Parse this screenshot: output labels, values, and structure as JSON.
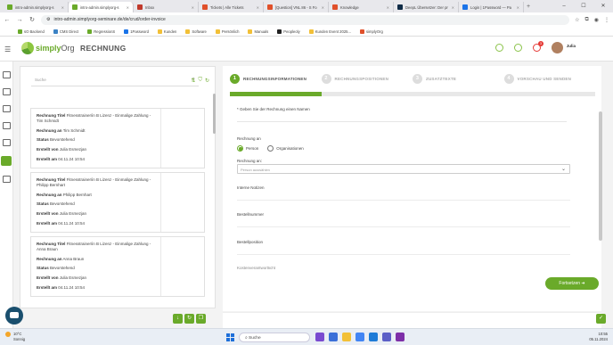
{
  "browser": {
    "tabs": [
      {
        "label": "intro-admin.simplyorg-s",
        "color": "#6aaa2a",
        "active": false
      },
      {
        "label": "intro-admin.simplyorg-s",
        "color": "#6aaa2a",
        "active": true
      },
      {
        "label": "Inbox",
        "color": "#c0392b",
        "active": false
      },
      {
        "label": "Tickets | Alle Tickets",
        "color": "#e0502a",
        "active": false
      },
      {
        "label": "[Question] VNL 86 - S Fo",
        "color": "#e0502a",
        "active": false
      },
      {
        "label": "Knowledge",
        "color": "#e0502a",
        "active": false
      },
      {
        "label": "DeepL Übersetzer: Der pr",
        "color": "#0f2b46",
        "active": false
      },
      {
        "label": "Login | 1Password — Pa",
        "color": "#1a73e8",
        "active": false
      }
    ],
    "url": "intro-admin.simplyorg-seminare.de/de/crud/order-invoice",
    "bookmarks": [
      {
        "label": "sO Backend",
        "color": "#6aaa2a"
      },
      {
        "label": "CMS Direct",
        "color": "#3b82c4"
      },
      {
        "label": "RegressionS",
        "color": "#6aaa2a"
      },
      {
        "label": "1Password",
        "color": "#1a73e8"
      },
      {
        "label": "Kunden",
        "color": "#f2c037"
      },
      {
        "label": "Software",
        "color": "#f2c037"
      },
      {
        "label": "Persönlich",
        "color": "#f2c037"
      },
      {
        "label": "Manuals",
        "color": "#f2c037"
      },
      {
        "label": "Peopleoly",
        "color": "#222"
      },
      {
        "label": "Kunden Event 2025...",
        "color": "#f2c037"
      },
      {
        "label": "simplyOrg",
        "color": "#e0502a"
      }
    ]
  },
  "app": {
    "logo_brand": "simply",
    "logo_suffix": "Org",
    "title": "RECHNUNG",
    "user_name": "Julia",
    "notification_count": "3"
  },
  "left_panel": {
    "search_placeholder": "Suche",
    "cards": [
      {
        "title_label": "Rechnung Titel",
        "title": "Fitnesstrainer/in B Lizenz - Einmalige Zahlung - Tim Schmidt",
        "recipient_label": "Rechnung an",
        "recipient": "Tim Schmidt",
        "status_label": "Status",
        "status": "Bevorstehend",
        "created_by_label": "Erstellt von",
        "created_by": "Julia Esmezjan",
        "created_at_label": "Erstellt am",
        "created_at": "04.11.24 10:54"
      },
      {
        "title_label": "Rechnung Titel",
        "title": "Fitnesstrainer/in B Lizenz - Einmalige Zahlung - Philipp Bernhart",
        "recipient_label": "Rechnung an",
        "recipient": "Philipp Bernhart",
        "status_label": "Status",
        "status": "Bevorstehend",
        "created_by_label": "Erstellt von",
        "created_by": "Julia Esmezjan",
        "created_at_label": "Erstellt am",
        "created_at": "04.11.24 10:54"
      },
      {
        "title_label": "Rechnung Titel",
        "title": "Fitnesstrainer/in B Lizenz - Einmalige Zahlung - Anna Braun",
        "recipient_label": "Rechnung an",
        "recipient": "Anna Braun",
        "status_label": "Status",
        "status": "Bevorstehend",
        "created_by_label": "Erstellt von",
        "created_by": "Julia Esmezjan",
        "created_at_label": "Erstellt am",
        "created_at": "04.11.24 10:54"
      }
    ]
  },
  "stepper": {
    "steps": [
      {
        "num": "1",
        "label": "RECHNUNGSINFORMATIONEN"
      },
      {
        "num": "2",
        "label": "RECHNUNGSPOSITIONEN"
      },
      {
        "num": "3",
        "label": "ZUSATZTEXTE"
      },
      {
        "num": "4",
        "label": "VORSCHAU UND SENDEN"
      }
    ],
    "progress": 0.25
  },
  "form": {
    "name_required": "* Geben Sie der Rechnung einen Namen",
    "recipient_type_label": "Rechnung an",
    "option_person": "Person",
    "option_org": "Organisationen",
    "recipient_label": "Rechnung an:",
    "recipient_placeholder": "Person auswählen",
    "internal_notes": "Interne Notizen",
    "order_number": "Bestellnummer",
    "order_position": "Bestellposition",
    "cut_label": "Kostenverantwortlicht"
  },
  "actions": {
    "continue": "Fortsetzen"
  },
  "taskbar": {
    "temp": "10°C",
    "weather": "Sonnig",
    "search": "Suche",
    "time": "10:55",
    "date": "05.11.2024"
  }
}
